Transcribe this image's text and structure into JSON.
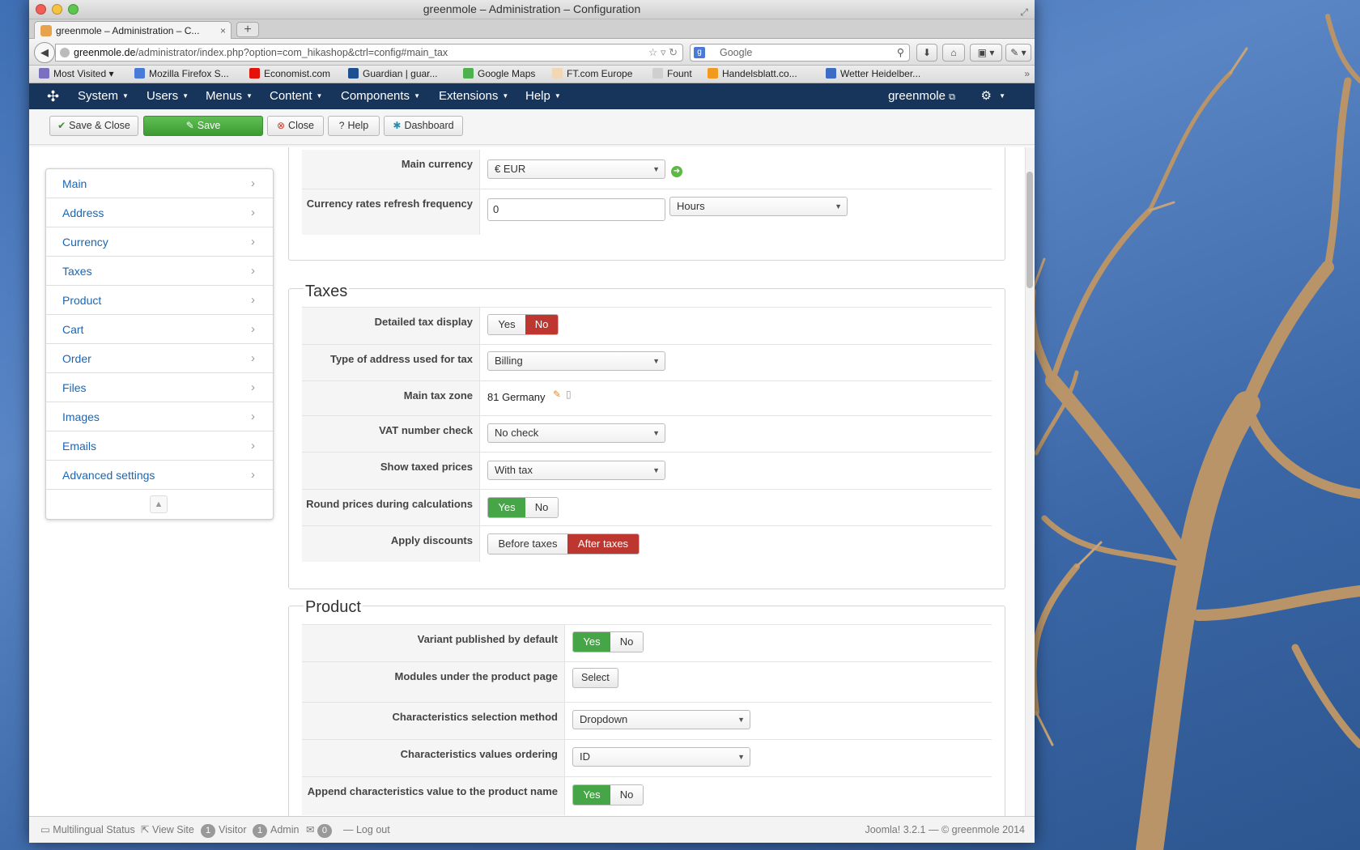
{
  "window": {
    "title": "greenmole – Administration – Configuration"
  },
  "browser": {
    "tab_title": "greenmole – Administration – C...",
    "url_host": "greenmole.de",
    "url_path": "/administrator/index.php?option=com_hikashop&ctrl=config#main_tax",
    "search_placeholder": "Google",
    "bookmarks": [
      {
        "label": "Most Visited ▾",
        "color": "#7b6fc0"
      },
      {
        "label": "Mozilla Firefox S...",
        "color": "#4a7ad8"
      },
      {
        "label": "Economist.com",
        "color": "#e3120b"
      },
      {
        "label": "Guardian | guar...",
        "color": "#1d4f91"
      },
      {
        "label": "Google Maps",
        "color": "#4db14d"
      },
      {
        "label": "FT.com Europe",
        "color": "#f2d7b5"
      },
      {
        "label": "Fount",
        "color": "#cfcfcf"
      },
      {
        "label": "Handelsblatt.co...",
        "color": "#f29a1f"
      },
      {
        "label": "Wetter Heidelber...",
        "color": "#3d6cc4"
      }
    ]
  },
  "joomla": {
    "menu": [
      "System",
      "Users",
      "Menus",
      "Content",
      "Components",
      "Extensions",
      "Help"
    ],
    "user": "greenmole",
    "toolbar": {
      "save_close": "Save & Close",
      "save": "Save",
      "close": "Close",
      "help": "Help",
      "dashboard": "Dashboard"
    }
  },
  "sidemenu": [
    "Main",
    "Address",
    "Currency",
    "Taxes",
    "Product",
    "Cart",
    "Order",
    "Files",
    "Images",
    "Emails",
    "Advanced settings"
  ],
  "currency": {
    "main_currency_label": "Main currency",
    "main_currency_value": "€ EUR",
    "refresh_label": "Currency rates refresh frequency",
    "refresh_value": "0",
    "refresh_unit": "Hours"
  },
  "taxes": {
    "legend": "Taxes",
    "detailed_label": "Detailed tax display",
    "address_label": "Type of address used for tax",
    "address_value": "Billing",
    "zone_label": "Main tax zone",
    "zone_value": "81 Germany",
    "vat_label": "VAT number check",
    "vat_value": "No check",
    "taxed_label": "Show taxed prices",
    "taxed_value": "With tax",
    "round_label": "Round prices during calculations",
    "discount_label": "Apply discounts",
    "before": "Before taxes",
    "after": "After taxes"
  },
  "product": {
    "legend": "Product",
    "variant_label": "Variant published by default",
    "modules_label": "Modules under the product page",
    "select": "Select",
    "method_label": "Characteristics selection method",
    "method_value": "Dropdown",
    "ordering_label": "Characteristics values ordering",
    "ordering_value": "ID",
    "append_label": "Append characteristics value to the product name"
  },
  "common": {
    "yes": "Yes",
    "no": "No"
  },
  "status": {
    "multilingual": "Multilingual Status",
    "view_site": "View Site",
    "visitor_count": "1",
    "visitor": "Visitor",
    "admin_count": "1",
    "admin": "Admin",
    "msg_count": "0",
    "logout": "Log out",
    "version": "Joomla! 3.2.1 — © greenmole 2014"
  }
}
